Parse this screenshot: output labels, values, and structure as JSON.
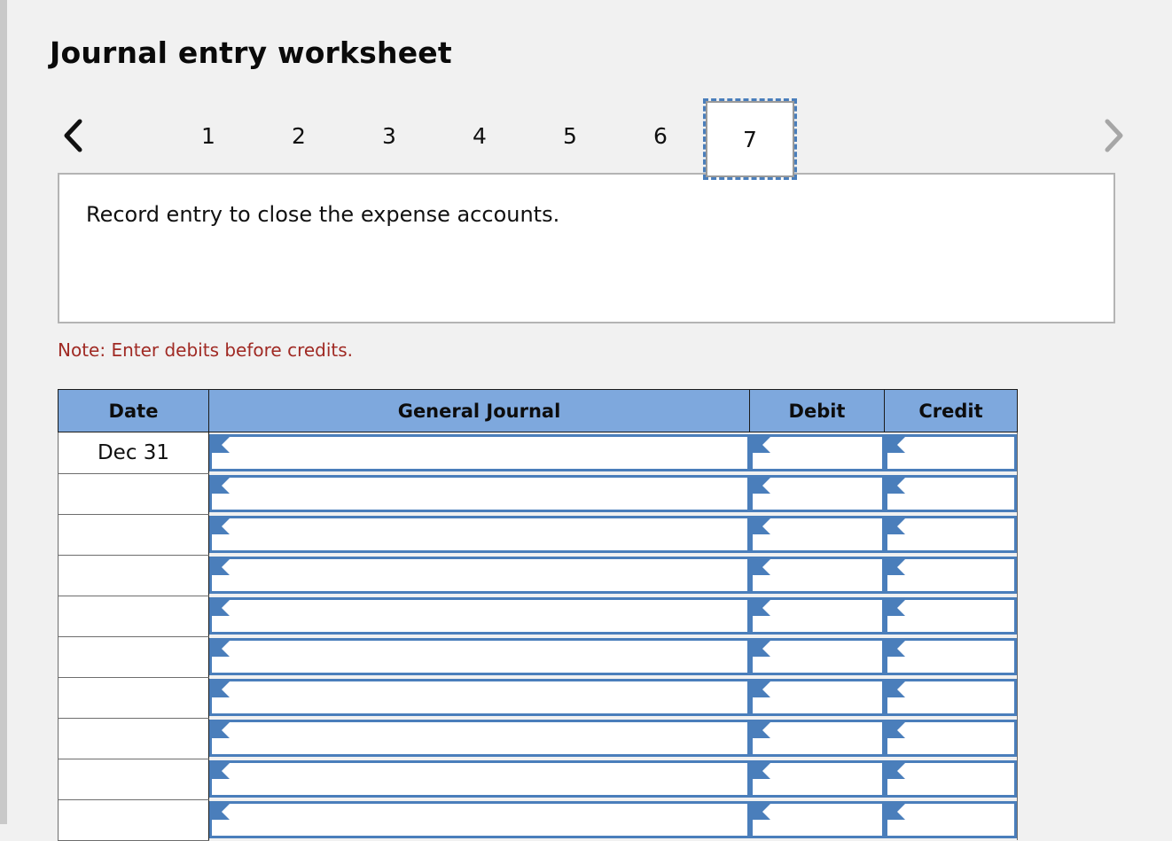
{
  "page": {
    "title": "Journal entry worksheet",
    "background_color": "#f1f1f1"
  },
  "tabs": {
    "prev_icon": "chevron-left-icon",
    "next_icon": "chevron-right-icon",
    "prev_enabled": true,
    "next_enabled": false,
    "active_index": 7,
    "items": [
      {
        "label": "1"
      },
      {
        "label": "2"
      },
      {
        "label": "3"
      },
      {
        "label": "4"
      },
      {
        "label": "5"
      },
      {
        "label": "6"
      },
      {
        "label": "7"
      }
    ],
    "active_border_color": "#4a7ebb"
  },
  "instruction": {
    "text": "Record entry to close the expense accounts."
  },
  "note": {
    "text": "Note: Enter debits before credits.",
    "color": "#a02a24"
  },
  "table": {
    "header_color": "#7ea8dd",
    "field_border_color": "#4a7ebb",
    "columns": [
      {
        "key": "date",
        "label": "Date"
      },
      {
        "key": "gj",
        "label": "General Journal"
      },
      {
        "key": "debit",
        "label": "Debit"
      },
      {
        "key": "credit",
        "label": "Credit"
      }
    ],
    "rows": [
      {
        "date": "Dec 31",
        "gj": "",
        "debit": "",
        "credit": ""
      },
      {
        "date": "",
        "gj": "",
        "debit": "",
        "credit": ""
      },
      {
        "date": "",
        "gj": "",
        "debit": "",
        "credit": ""
      },
      {
        "date": "",
        "gj": "",
        "debit": "",
        "credit": ""
      },
      {
        "date": "",
        "gj": "",
        "debit": "",
        "credit": ""
      },
      {
        "date": "",
        "gj": "",
        "debit": "",
        "credit": ""
      },
      {
        "date": "",
        "gj": "",
        "debit": "",
        "credit": ""
      },
      {
        "date": "",
        "gj": "",
        "debit": "",
        "credit": ""
      },
      {
        "date": "",
        "gj": "",
        "debit": "",
        "credit": ""
      },
      {
        "date": "",
        "gj": "",
        "debit": "",
        "credit": ""
      }
    ]
  }
}
